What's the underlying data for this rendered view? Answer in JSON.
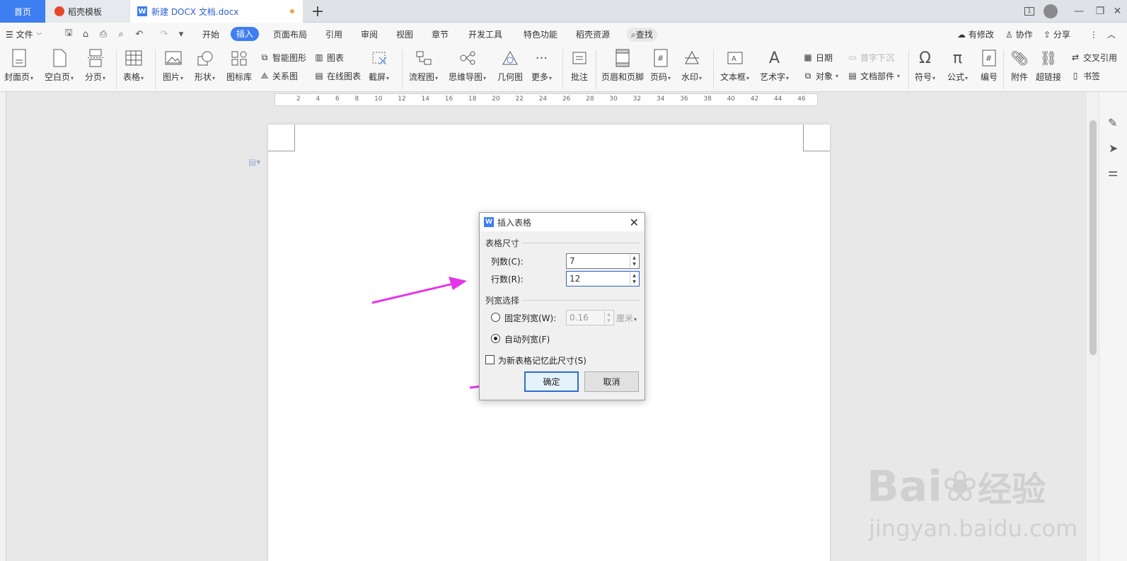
{
  "tabs": {
    "home": "首页",
    "template": "稻壳模板",
    "document": "新建 DOCX 文档.docx",
    "new_tab": "+"
  },
  "window": {
    "page_indicator": "1"
  },
  "menu": {
    "file": "文件",
    "items": [
      "开始",
      "插入",
      "页面布局",
      "引用",
      "审阅",
      "视图",
      "章节",
      "开发工具",
      "特色功能",
      "稻壳资源"
    ],
    "active": "插入",
    "search": "查找",
    "right": [
      "有修改",
      "协作",
      "分享"
    ]
  },
  "ribbon": {
    "cover": "封面页",
    "blank": "空白页",
    "pagebreak": "分页",
    "table": "表格",
    "picture": "图片",
    "shape": "形状",
    "iconlib": "图标库",
    "smartart": "智能图形",
    "relation": "关系图",
    "chart": "图表",
    "onlinechart": "在线图表",
    "screenshot": "截屏",
    "flowchart": "流程图",
    "mindmap": "思维导图",
    "geometry": "几何图",
    "more": "更多",
    "comment": "批注",
    "headerfooter": "页眉和页脚",
    "pagenum": "页码",
    "watermark": "水印",
    "textbox": "文本框",
    "wordart": "艺术字",
    "date": "日期",
    "object": "对象",
    "dropcap": "首字下沉",
    "docparts": "文档部件",
    "symbol": "符号",
    "formula": "公式",
    "numbering": "编号",
    "attachment": "附件",
    "hyperlink": "超链接",
    "crossref": "交叉引用",
    "bookmark": "书签"
  },
  "ruler": {
    "ticks": [
      "2",
      "4",
      "6",
      "8",
      "10",
      "12",
      "14",
      "16",
      "18",
      "20",
      "22",
      "24",
      "26",
      "28",
      "30",
      "32",
      "34",
      "36",
      "38",
      "40",
      "42",
      "44",
      "46"
    ]
  },
  "dialog": {
    "title": "插入表格",
    "size_group": "表格尺寸",
    "columns_label": "列数(C):",
    "columns_value": "7",
    "rows_label": "行数(R):",
    "rows_value": "12",
    "width_group": "列宽选择",
    "fixed_label": "固定列宽(W):",
    "fixed_value": "0.16",
    "fixed_unit": "厘米",
    "auto_label": "自动列宽(F)",
    "remember_label": "为新表格记忆此尺寸(S)",
    "ok": "确定",
    "cancel": "取消",
    "selected_mode": "auto",
    "remember_checked": false
  },
  "watermark": {
    "brand": "Bai",
    "brand2": "经验",
    "url": "jingyan.baidu.com"
  },
  "colors": {
    "accent": "#3d7ef0",
    "annotation_arrow": "#e535e8"
  }
}
